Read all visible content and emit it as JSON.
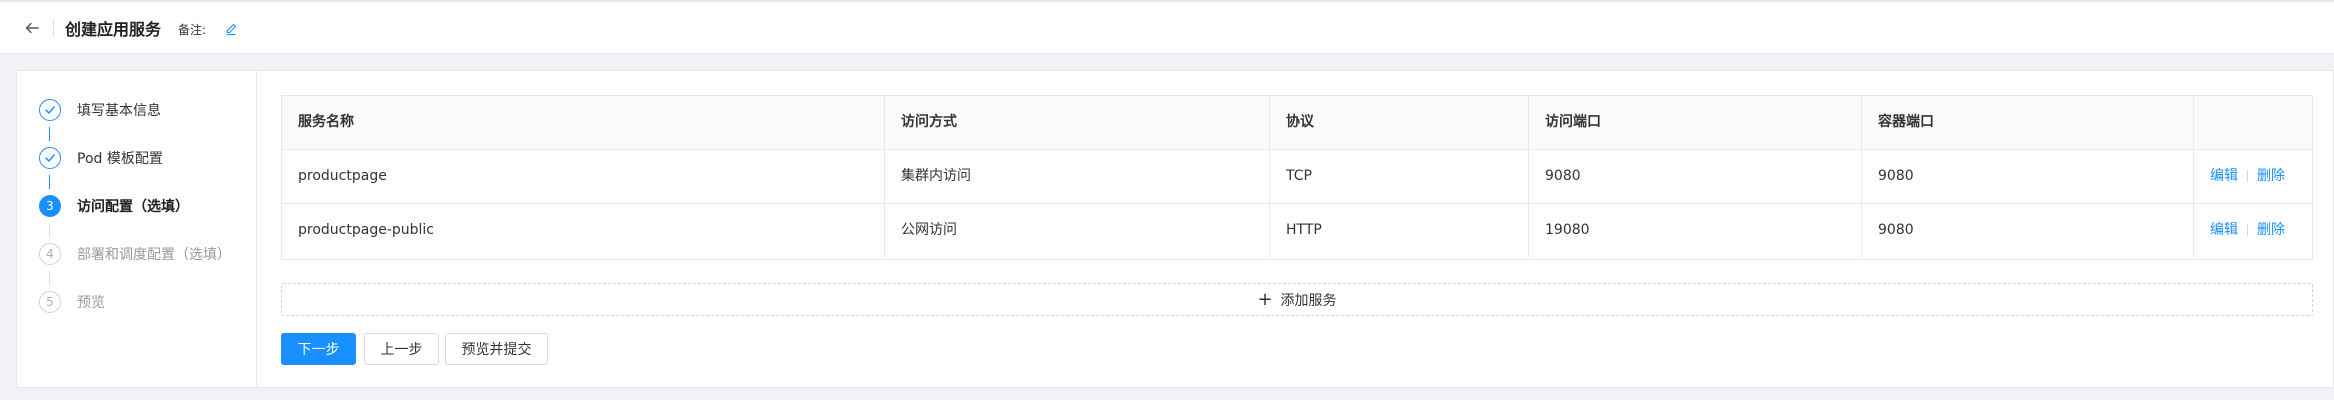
{
  "header": {
    "title": "创建应用服务",
    "note_label": "备注:"
  },
  "steps": [
    {
      "label": "填写基本信息",
      "number": "1",
      "state": "done"
    },
    {
      "label": "Pod 模板配置",
      "number": "2",
      "state": "done"
    },
    {
      "label": "访问配置（选填）",
      "number": "3",
      "state": "active"
    },
    {
      "label": "部署和调度配置（选填）",
      "number": "4",
      "state": "pending"
    },
    {
      "label": "预览",
      "number": "5",
      "state": "pending"
    }
  ],
  "table": {
    "headers": [
      "服务名称",
      "访问方式",
      "协议",
      "访问端口",
      "容器端口"
    ],
    "rows": [
      {
        "name": "productpage",
        "access": "集群内访问",
        "protocol": "TCP",
        "port": "9080",
        "container_port": "9080",
        "edit": "编辑",
        "delete": "删除"
      },
      {
        "name": "productpage-public",
        "access": "公网访问",
        "protocol": "HTTP",
        "port": "19080",
        "container_port": "9080",
        "edit": "编辑",
        "delete": "删除"
      }
    ]
  },
  "add_service_label": "添加服务",
  "buttons": {
    "next": "下一步",
    "prev": "上一步",
    "preview_submit": "预览并提交"
  },
  "colors": {
    "accent": "#1890ff",
    "page_bg": "#f0f2f5"
  }
}
